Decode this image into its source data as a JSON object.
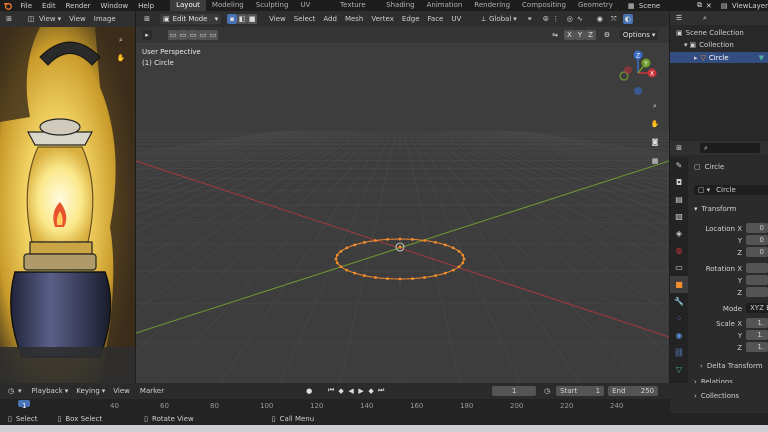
{
  "topbar": {
    "menus": [
      "File",
      "Edit",
      "Render",
      "Window",
      "Help"
    ],
    "workspaces": [
      "Layout",
      "Modeling",
      "Sculpting",
      "UV Editing",
      "Texture Paint",
      "Shading",
      "Animation",
      "Rendering",
      "Compositing",
      "Geometry Nod"
    ],
    "active_workspace": "Layout",
    "scene": "Scene",
    "view_layer": "ViewLayer"
  },
  "image_editor": {
    "menus": [
      "View",
      "View",
      "Image"
    ]
  },
  "viewport": {
    "mode": "Edit Mode",
    "menus": [
      "View",
      "Select",
      "Add",
      "Mesh",
      "Vertex",
      "Edge",
      "Face",
      "UV"
    ],
    "orientation": "Global",
    "overlay_title": "User Perspective",
    "overlay_object": "(1) Circle",
    "options_label": "Options",
    "axis_labels": [
      "X",
      "Y",
      "Z"
    ],
    "gizmo": {
      "z": "Z",
      "y": "Y",
      "x": "X"
    }
  },
  "outliner": {
    "scene_collection": "Scene Collection",
    "collection": "Collection",
    "object": "Circle"
  },
  "properties": {
    "object_name": "Circle",
    "data_name": "Circle",
    "transform_label": "Transform",
    "location_label": "Location X",
    "rotation_label": "Rotation X",
    "scale_label": "Scale X",
    "y_label": "Y",
    "z_label": "Z",
    "location_values": [
      "0",
      "0",
      "0"
    ],
    "rotation_values": [
      "",
      "",
      ""
    ],
    "scale_values": [
      "1.",
      "1.",
      "1."
    ],
    "mode_label": "Mode",
    "mode_value": "XYZ E",
    "delta_transform": "Delta Transform",
    "relations": "Relations",
    "collections": "Collections"
  },
  "timeline": {
    "menus": [
      "Playback",
      "Keying",
      "View",
      "Marker"
    ],
    "current_frame": "1",
    "start_label": "Start",
    "start_value": "1",
    "end_label": "End",
    "end_value": "250",
    "ruler": [
      "1",
      "40",
      "60",
      "80",
      "100",
      "120",
      "140",
      "160",
      "180",
      "200",
      "220",
      "240"
    ]
  },
  "statusbar": {
    "items": [
      "Select",
      "Box Select",
      "Rotate View",
      "Call Menu"
    ]
  },
  "colors": {
    "accent": "#4772b3",
    "selection": "#f58d2c",
    "x_axis": "#a33a3a",
    "y_axis": "#6f9a2e"
  }
}
